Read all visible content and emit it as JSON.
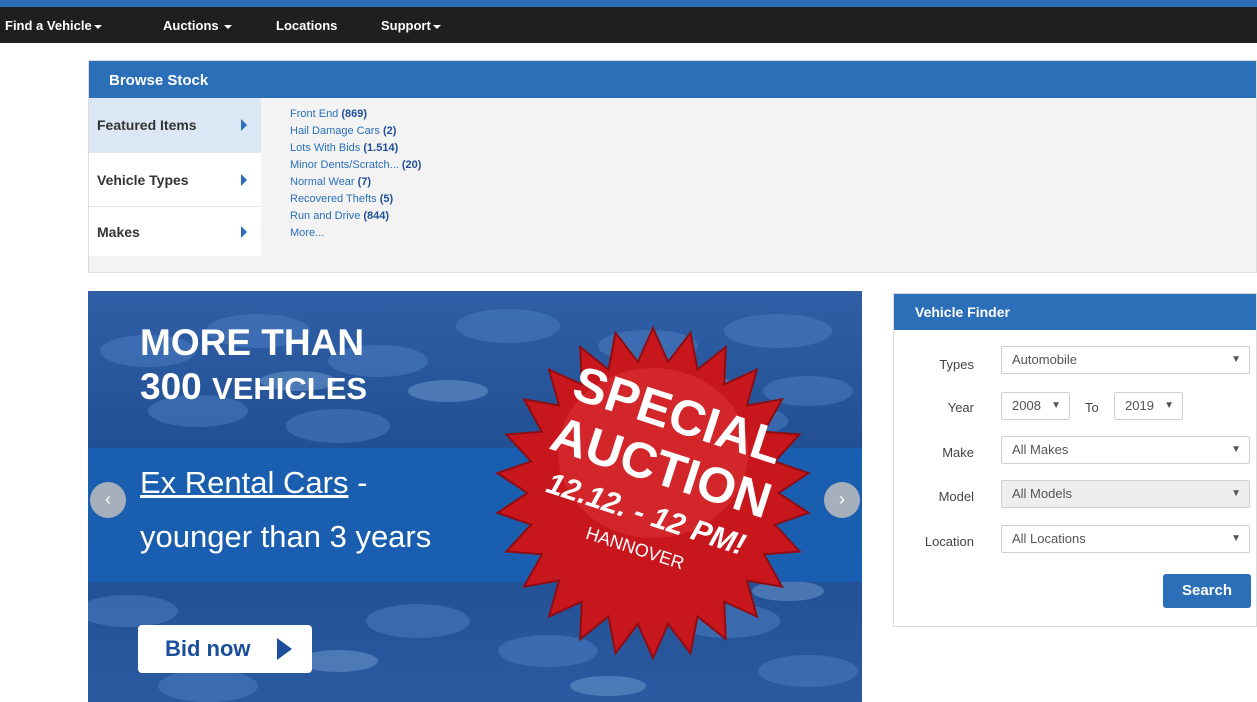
{
  "nav": {
    "items": [
      {
        "label": "Find a Vehicle",
        "has_dropdown": true
      },
      {
        "label": "Auctions",
        "has_dropdown": true
      },
      {
        "label": "Locations",
        "has_dropdown": false
      },
      {
        "label": "Support",
        "has_dropdown": true
      }
    ]
  },
  "browse": {
    "title": "Browse Stock",
    "categories": [
      {
        "label": "Featured Items",
        "selected": true
      },
      {
        "label": "Vehicle Types",
        "selected": false
      },
      {
        "label": "Makes",
        "selected": false
      }
    ],
    "items": [
      {
        "name": "Front End",
        "count": "(869)"
      },
      {
        "name": "Hail Damage Cars",
        "count": "(2)"
      },
      {
        "name": "Lots With Bids",
        "count": "(1.514)"
      },
      {
        "name": "Minor Dents/Scratch...",
        "count": "(20)"
      },
      {
        "name": "Normal Wear",
        "count": "(7)"
      },
      {
        "name": "Recovered Thefts",
        "count": "(5)"
      },
      {
        "name": "Run and Drive",
        "count": "(844)"
      }
    ],
    "more_label": "More..."
  },
  "banner": {
    "headline_line1": "MORE THAN",
    "headline_num": "300",
    "headline_line2": "VEHICLES",
    "sub_link": "Ex Rental Cars",
    "sub_dash": " -",
    "sub_line2": "younger than 3 years",
    "special_line1": "SPECIAL",
    "special_line2": "AUCTION",
    "special_date": "12.12. - 12 PM!",
    "special_city": "HANNOVER",
    "bid_label": "Bid now",
    "prev_glyph": "‹",
    "next_glyph": "›"
  },
  "finder": {
    "title": "Vehicle Finder",
    "types_label": "Types",
    "types_value": "Automobile",
    "year_label": "Year",
    "year_from": "2008",
    "year_to_label": "To",
    "year_to": "2019",
    "make_label": "Make",
    "make_value": "All Makes",
    "model_label": "Model",
    "model_value": "All Models",
    "location_label": "Location",
    "location_value": "All Locations",
    "search_label": "Search"
  },
  "colors": {
    "primary": "#2a6fb8",
    "navbar": "#1f1f1f",
    "starburst": "#c8161d"
  }
}
